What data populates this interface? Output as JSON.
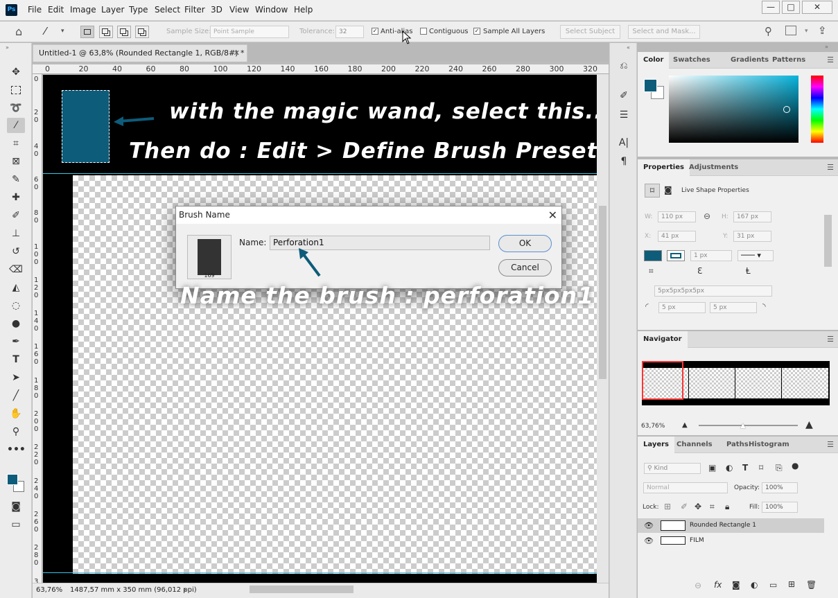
{
  "app": {
    "logo": "Ps"
  },
  "menu": [
    "File",
    "Edit",
    "Image",
    "Layer",
    "Type",
    "Select",
    "Filter",
    "3D",
    "View",
    "Window",
    "Help"
  ],
  "window_controls": {
    "minimize": "—",
    "maximize": "□",
    "close": "✕"
  },
  "options": {
    "sample_size_label": "Sample Size:",
    "sample_size_value": "Point Sample",
    "tolerance_label": "Tolerance:",
    "tolerance_value": "32",
    "anti_alias": "Anti-alias",
    "contiguous": "Contiguous",
    "sample_all_layers": "Sample All Layers",
    "select_subject": "Select Subject",
    "select_and_mask": "Select and Mask..."
  },
  "document": {
    "tab_title": "Untitled-1 @ 63,8% (Rounded Rectangle 1, RGB/8#) *",
    "ruler_h": [
      "0",
      "20",
      "40",
      "60",
      "80",
      "100",
      "120",
      "140",
      "160",
      "180",
      "200",
      "220",
      "240",
      "260",
      "280",
      "300",
      "320"
    ],
    "ruler_v": [
      "0",
      "20",
      "40",
      "60",
      "80",
      "100",
      "120",
      "140",
      "160",
      "180",
      "200",
      "220",
      "240",
      "260",
      "280",
      "3"
    ],
    "annotation_1": "with the magic wand, select this...",
    "annotation_2": "Then do : Edit > Define Brush Preset",
    "annotation_3": "Name the brush : perforation1",
    "status_zoom": "63,76%",
    "status_info": "1487,57 mm x 350 mm (96,012 ppi)"
  },
  "dialog": {
    "title": "Brush Name",
    "name_label": "Name:",
    "name_value": "Perforation1",
    "brush_size": "169",
    "ok": "OK",
    "cancel": "Cancel"
  },
  "color_panel": {
    "tabs": [
      "Color",
      "Swatches",
      "Gradients",
      "Patterns"
    ],
    "foreground": "#0d5c7a",
    "background": "#ffffff"
  },
  "properties_panel": {
    "tabs": [
      "Properties",
      "Adjustments"
    ],
    "subtitle": "Live Shape Properties",
    "w_label": "W:",
    "w": "110 px",
    "h_label": "H:",
    "h": "167 px",
    "x_label": "X:",
    "x": "41 px",
    "y_label": "Y:",
    "y": "31 px",
    "stroke_width": "1 px",
    "radii": "5px5px5px5px",
    "radius_1": "5 px",
    "radius_2": "5 px"
  },
  "navigator": {
    "tab": "Navigator",
    "zoom": "63,76%"
  },
  "layers_panel": {
    "tabs": [
      "Layers",
      "Channels",
      "Paths",
      "Histogram"
    ],
    "kind": "Kind",
    "blend": "Normal",
    "opacity_label": "Opacity:",
    "opacity": "100%",
    "lock_label": "Lock:",
    "fill_label": "Fill:",
    "fill": "100%",
    "layers": [
      "Rounded Rectangle 1",
      "FILM"
    ]
  }
}
